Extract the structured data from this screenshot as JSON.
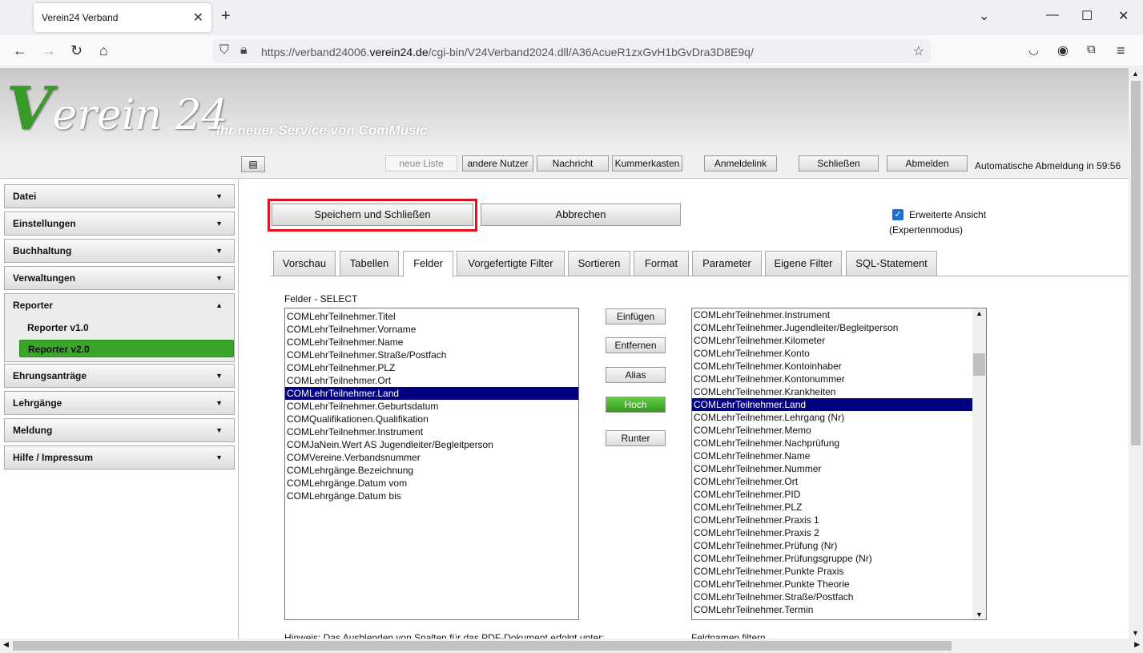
{
  "browser": {
    "tab_title": "Verein24 Verband",
    "url_prefix": "https://verband24006.",
    "url_domain": "verein24.de",
    "url_path": "/cgi-bin/V24Verband2024.dll/A36AcueR1zxGvH1bGvDra3D8E9q/"
  },
  "header": {
    "logo_text": "erein 24",
    "logo_v": "V",
    "tagline": "Ihr neuer Service von ComMusic"
  },
  "toolbar": {
    "neue_liste": "neue Liste",
    "andere_nutzer": "andere Nutzer",
    "nachricht": "Nachricht",
    "kummerkasten": "Kummerkasten",
    "anmeldelink": "Anmeldelink",
    "schliessen": "Schließen",
    "abmelden": "Abmelden",
    "timer": "Automatische Abmeldung in 59:56"
  },
  "sidebar": {
    "items": [
      "Datei",
      "Einstellungen",
      "Buchhaltung",
      "Verwaltungen",
      "Reporter",
      "Ehrungsanträge",
      "Lehrgänge",
      "Meldung",
      "Hilfe / Impressum"
    ],
    "reporter_sub": [
      "Reporter v1.0",
      "Reporter v2.0"
    ],
    "accent": "#3aa52a"
  },
  "main": {
    "save_close": "Speichern und Schließen",
    "cancel": "Abbrechen",
    "extended_view": "Erweiterte Ansicht",
    "expert_mode": "(Expertenmodus)",
    "tabs": [
      "Vorschau",
      "Tabellen",
      "Felder",
      "Vorgefertigte Filter",
      "Sortieren",
      "Format",
      "Parameter",
      "Eigene Filter",
      "SQL-Statement"
    ],
    "fields_label": "Felder - SELECT",
    "selected_fields": [
      "COMLehrTeilnehmer.Titel",
      "COMLehrTeilnehmer.Vorname",
      "COMLehrTeilnehmer.Name",
      "COMLehrTeilnehmer.Straße/Postfach",
      "COMLehrTeilnehmer.PLZ",
      "COMLehrTeilnehmer.Ort",
      "COMLehrTeilnehmer.Land",
      "COMLehrTeilnehmer.Geburtsdatum",
      "COMQualifikationen.Qualifikation",
      "COMLehrTeilnehmer.Instrument",
      "COMJaNein.Wert AS Jugendleiter/Begleitperson",
      "COMVereine.Verbandsnummer",
      "COMLehrgänge.Bezeichnung",
      "COMLehrgänge.Datum vom",
      "COMLehrgänge.Datum bis"
    ],
    "buttons": {
      "einfuegen": "Einfügen",
      "entfernen": "Entfernen",
      "alias": "Alias",
      "hoch": "Hoch",
      "runter": "Runter"
    },
    "available_fields": [
      "COMLehrTeilnehmer.Instrument",
      "COMLehrTeilnehmer.Jugendleiter/Begleitperson",
      "COMLehrTeilnehmer.Kilometer",
      "COMLehrTeilnehmer.Konto",
      "COMLehrTeilnehmer.Kontoinhaber",
      "COMLehrTeilnehmer.Kontonummer",
      "COMLehrTeilnehmer.Krankheiten",
      "COMLehrTeilnehmer.Land",
      "COMLehrTeilnehmer.Lehrgang (Nr)",
      "COMLehrTeilnehmer.Memo",
      "COMLehrTeilnehmer.Nachprüfung",
      "COMLehrTeilnehmer.Name",
      "COMLehrTeilnehmer.Nummer",
      "COMLehrTeilnehmer.Ort",
      "COMLehrTeilnehmer.PID",
      "COMLehrTeilnehmer.PLZ",
      "COMLehrTeilnehmer.Praxis 1",
      "COMLehrTeilnehmer.Praxis 2",
      "COMLehrTeilnehmer.Prüfung (Nr)",
      "COMLehrTeilnehmer.Prüfungsgruppe (Nr)",
      "COMLehrTeilnehmer.Punkte Praxis",
      "COMLehrTeilnehmer.Punkte Theorie",
      "COMLehrTeilnehmer.Straße/Postfach",
      "COMLehrTeilnehmer.Termin"
    ],
    "hint": "Hinweis: Das Ausblenden von Spalten für das PDF-Dokument erfolgt unter:",
    "filter_label": "Feldnamen filtern"
  }
}
